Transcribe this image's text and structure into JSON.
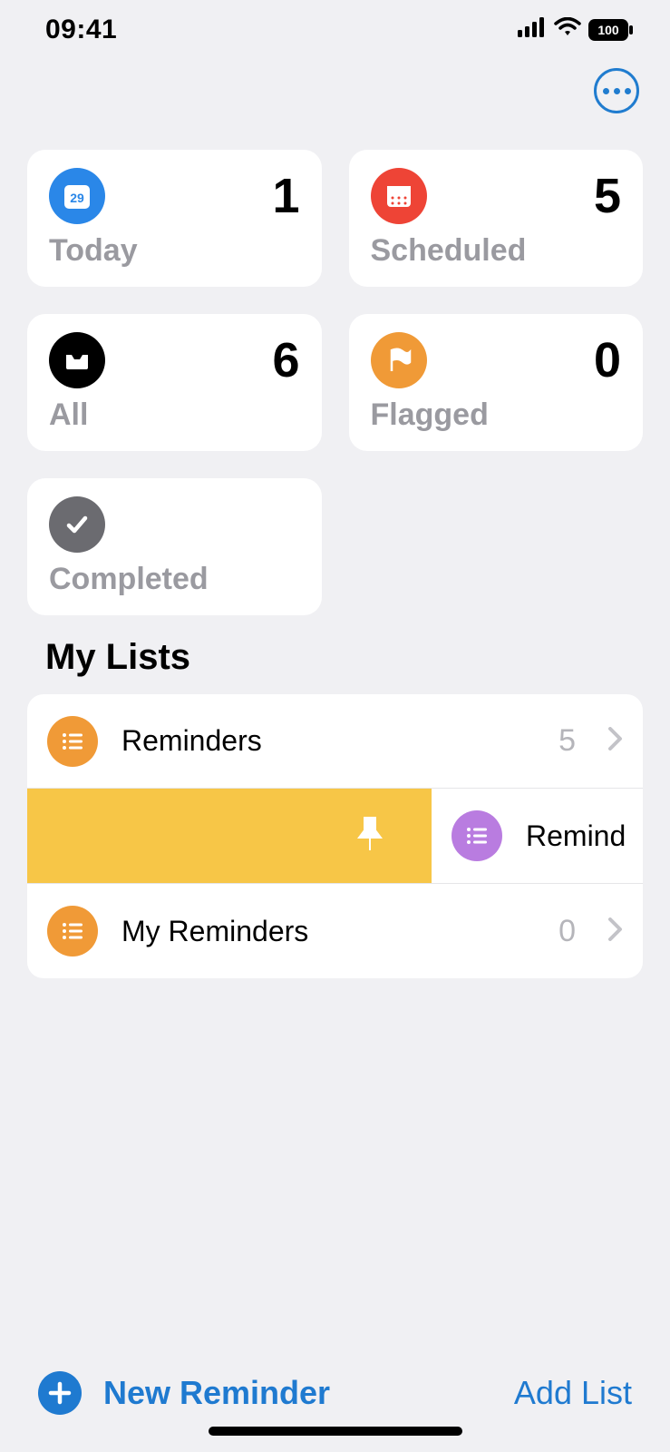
{
  "status": {
    "time": "09:41",
    "battery": "100"
  },
  "cards": {
    "today": {
      "label": "Today",
      "count": "1",
      "date": "29"
    },
    "scheduled": {
      "label": "Scheduled",
      "count": "5"
    },
    "all": {
      "label": "All",
      "count": "6"
    },
    "flagged": {
      "label": "Flagged",
      "count": "0"
    },
    "completed": {
      "label": "Completed"
    }
  },
  "section_title": "My Lists",
  "lists": {
    "0": {
      "name": "Reminders",
      "count": "5",
      "color": "#f09a37"
    },
    "1": {
      "name": "Remind",
      "color": "#b97ce0"
    },
    "2": {
      "name": "My Reminders",
      "count": "0",
      "color": "#f09a37"
    }
  },
  "bottom": {
    "new_reminder": "New Reminder",
    "add_list": "Add List"
  }
}
